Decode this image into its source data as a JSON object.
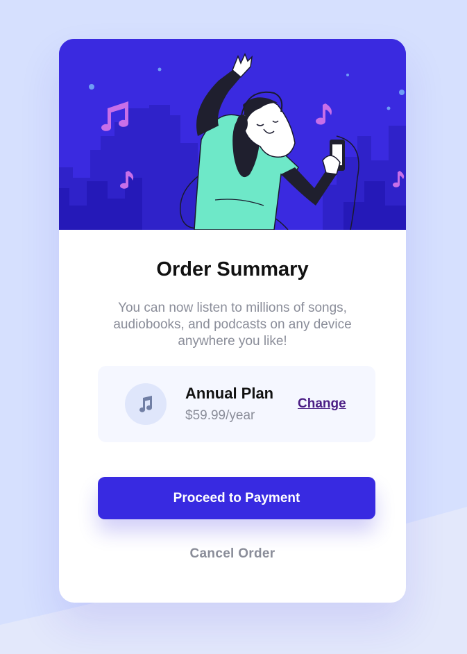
{
  "colors": {
    "page_background": "#d6e0fe",
    "hero_background": "#3a2ae0",
    "accent": "#382ae1",
    "link": "#4b1e85",
    "muted_text": "#8a8d99",
    "plan_background": "#f5f7ff"
  },
  "hero": {
    "illustration": "person-dancing-with-headphones-icon"
  },
  "summary": {
    "title": "Order Summary",
    "description": "You can now listen to millions of songs, audiobooks, and podcasts on any device anywhere you like!"
  },
  "plan": {
    "icon": "music-note-icon",
    "name": "Annual Plan",
    "price": "$59.99/year",
    "change_label": "Change"
  },
  "actions": {
    "proceed_label": "Proceed to Payment",
    "cancel_label": "Cancel Order"
  }
}
